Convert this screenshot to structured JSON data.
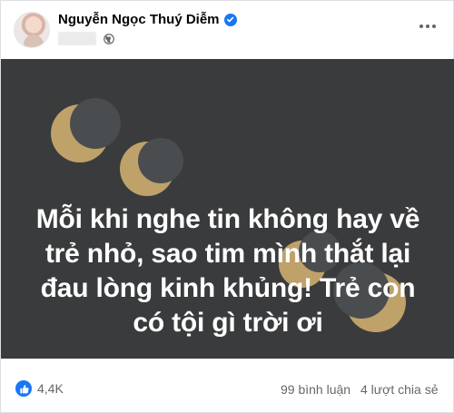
{
  "post": {
    "author_name": "Nguyễn Ngọc Thuý Diễm",
    "verified": true,
    "privacy_icon": "globe-icon",
    "more_icon": "more-options-icon",
    "image_text_lines": [
      "Mỗi khi nghe tin không hay về",
      "trẻ nhỏ, sao tim mình thắt lại",
      "đau lòng kinh khủng! Trẻ con",
      "có tội gì trời ơi"
    ],
    "colors": {
      "background": "#3a3b3c",
      "moon_gold": "#bfa16a",
      "moon_dark": "#4a4d50",
      "link_blue": "#1877f2"
    }
  },
  "footer": {
    "reaction_icon": "like-icon",
    "reactions": "4,4K",
    "comments": "99 bình luận",
    "shares": "4 lượt chia sẻ"
  }
}
